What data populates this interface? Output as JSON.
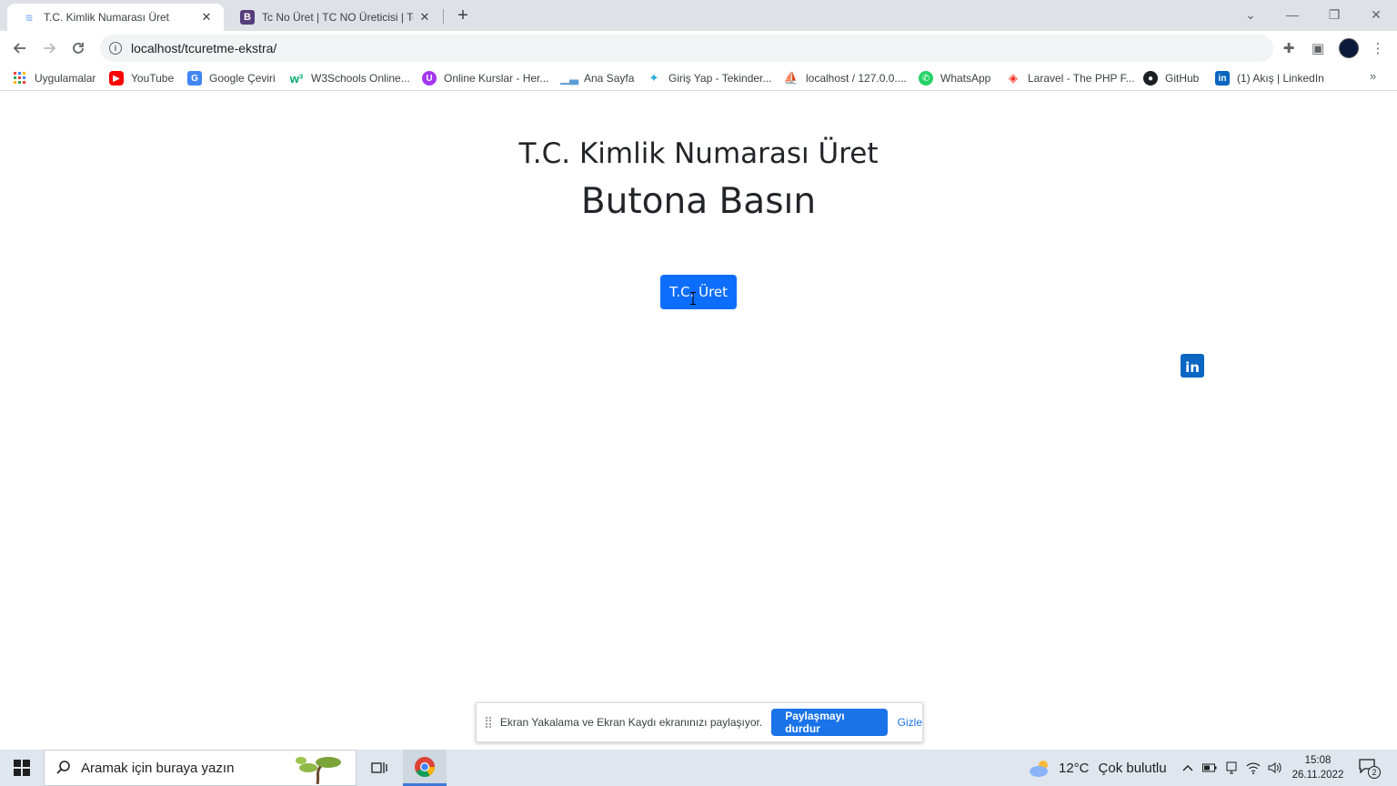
{
  "browser": {
    "tabs": [
      {
        "title": "T.C. Kimlik Numarası Üret",
        "active": true
      },
      {
        "title": "Tc No Üret | TC NO Üreticisi | Tc",
        "active": false
      }
    ],
    "new_tab_label": "+",
    "address": "localhost/tcuretme-ekstra/",
    "bookmarks": [
      {
        "label": "Uygulamalar",
        "icon": "apps-grid-icon"
      },
      {
        "label": "YouTube",
        "icon": "youtube-icon"
      },
      {
        "label": "Google Çeviri",
        "icon": "google-translate-icon"
      },
      {
        "label": "W3Schools Online...",
        "icon": "w3schools-icon"
      },
      {
        "label": "Online Kurslar - Her...",
        "icon": "udemy-icon"
      },
      {
        "label": "Ana Sayfa",
        "icon": "chart-icon"
      },
      {
        "label": "Giriş Yap - Tekinder...",
        "icon": "person-icon"
      },
      {
        "label": "localhost / 127.0.0....",
        "icon": "phpmyadmin-icon"
      },
      {
        "label": "WhatsApp",
        "icon": "whatsapp-icon"
      },
      {
        "label": "Laravel - The PHP F...",
        "icon": "laravel-icon"
      },
      {
        "label": "GitHub",
        "icon": "github-icon"
      },
      {
        "label": "(1) Akış | LinkedIn",
        "icon": "linkedin-icon"
      }
    ],
    "more_bookmarks": "»"
  },
  "page": {
    "title": "T.C. Kimlik Numarası Üret",
    "subtitle": "Butona Basın",
    "button_label": "T.C. Üret",
    "linkedin_label": "in"
  },
  "share_bar": {
    "message": "Ekran Yakalama ve Ekran Kaydı ekranınızı paylaşıyor.",
    "stop_label": "Paylaşmayı durdur",
    "hide_label": "Gizle"
  },
  "taskbar": {
    "search_placeholder": "Aramak için buraya yazın",
    "weather_temp": "12°C",
    "weather_desc": "Çok bulutlu",
    "time": "15:08",
    "date": "26.11.2022",
    "notification_count": "2"
  },
  "colors": {
    "primary_button": "#0d6efd",
    "share_button": "#1a73e8",
    "linkedin": "#0a66c2"
  }
}
